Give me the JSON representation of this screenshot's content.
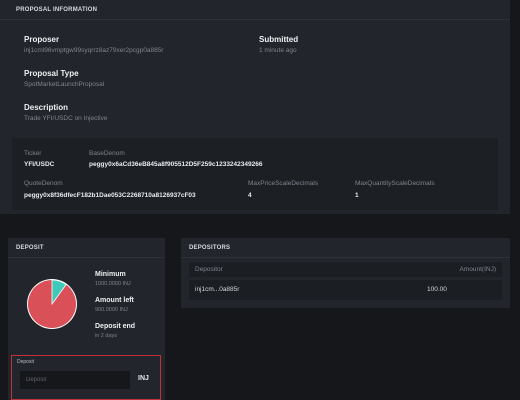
{
  "proposal": {
    "header": "PROPOSAL INFORMATION",
    "proposer_label": "Proposer",
    "proposer_value": "inj1cml96vmptgw99syqrrz8az79xer2pcgp0a885r",
    "submitted_label": "Submitted",
    "submitted_value": "1 minute ago",
    "type_label": "Proposal Type",
    "type_value": "SpotMarketLaunchProposal",
    "description_label": "Description",
    "description_value": "Trade YFI/USDC on Injective",
    "ticker_label": "Ticker",
    "ticker_value": "YFI/USDC",
    "base_denom_label": "BaseDenom",
    "base_denom_value": "peggy0x6aCd36eB845a8f905512D5F259c1233242349266",
    "quote_denom_label": "QuoteDenom",
    "quote_denom_value": "peggy0x8f36dfecF182b1Dae053C2268710a8126937cF03",
    "max_price_label": "MaxPriceScaleDecimals",
    "max_price_value": "4",
    "max_qty_label": "MaxQuantityScaleDecimals",
    "max_qty_value": "1"
  },
  "deposit": {
    "header": "DEPOSIT",
    "minimum_label": "Minimum",
    "minimum_value": "1000.0000 INJ",
    "amount_left_label": "Amount left",
    "amount_left_value": "900.0000 INJ",
    "deposit_end_label": "Deposit end",
    "deposit_end_value": "in 2 days",
    "pie_fraction_deposited": 0.1,
    "pie_colors": {
      "deposited": "#3fc9b8",
      "remaining": "#d95059"
    },
    "form_label": "Deposit",
    "input_placeholder": "Deposit",
    "unit": "INJ"
  },
  "depositors": {
    "header": "DEPOSITORS",
    "columns": [
      "Depositor",
      "Amount(INJ)"
    ],
    "rows": [
      {
        "depositor": "inj1cm...0a885r",
        "amount": "100.00"
      }
    ]
  }
}
